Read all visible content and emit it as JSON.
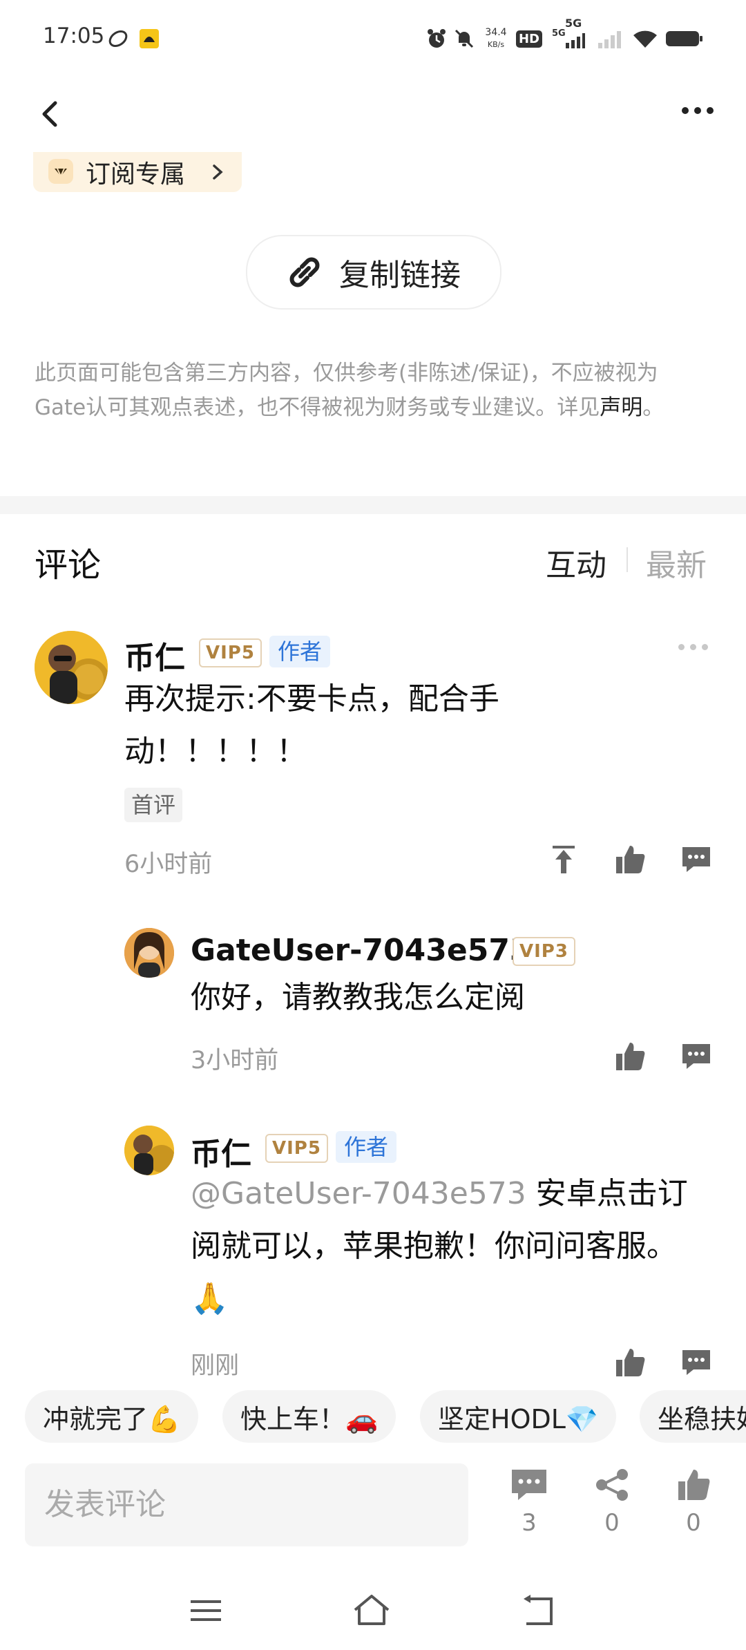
{
  "status_bar": {
    "time": "17:05",
    "net_speed": "34.4",
    "net_unit": "KB/s",
    "hd_label": "HD",
    "signal_label": "5G"
  },
  "header": {
    "subscribe_chip": "订阅专属"
  },
  "share": {
    "copy_link_label": "复制链接"
  },
  "disclaimer": {
    "text": "此页面可能包含第三方内容，仅供参考(非陈述/保证)，不应被视为Gate认可其观点表述，也不得被视为财务或专业建议。详见",
    "link": "声明",
    "tail": "。"
  },
  "comments_section": {
    "title": "评论",
    "tab_interactive": "互动",
    "tab_latest": "最新"
  },
  "comments": [
    {
      "user": "币仁",
      "vip": "VIP5",
      "badge": "作者",
      "line1": "再次提示:不要卡点，配合手",
      "line2": "动！！！！！",
      "tag": "首评",
      "time": "6小时前"
    },
    {
      "user": "GateUser-7043e573",
      "vip": "VIP3",
      "text": "你好，请教教我怎么定阅",
      "time": "3小时前"
    },
    {
      "user": "币仁",
      "vip": "VIP5",
      "badge": "作者",
      "mention": "@GateUser-7043e573",
      "line1": " 安卓点击订",
      "line2": "阅就可以，苹果抱歉！你问问客服。",
      "emoji": "🙏",
      "time": "刚刚"
    }
  ],
  "quick_replies": [
    "冲就完了💪",
    "快上车！🚗",
    "坚定HODL💎",
    "坐稳扶好"
  ],
  "bottom_bar": {
    "input_placeholder": "发表评论",
    "comment_count": "3",
    "share_count": "0",
    "like_count": "0"
  },
  "colors": {
    "accent_blue": "#2d74d8",
    "vip_gold": "#b0823f",
    "chip_bg": "#fdf3e2"
  }
}
